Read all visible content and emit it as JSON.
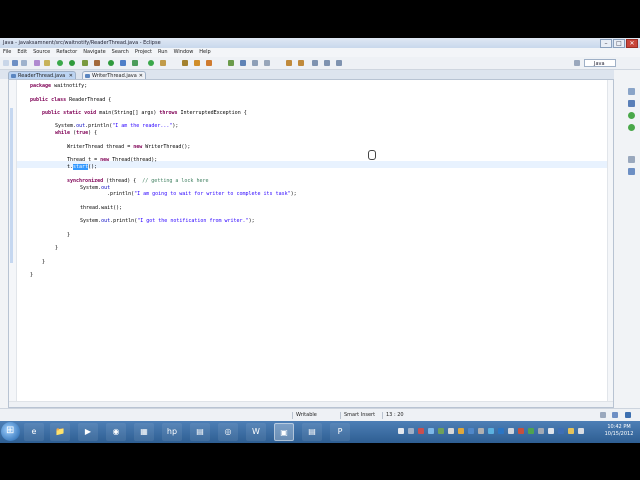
{
  "window": {
    "title": "Java - javaksamnent/src/waitnotify/ReaderThread.java - Eclipse",
    "controls": [
      "–",
      "□",
      "✕"
    ]
  },
  "menu": [
    "File",
    "Edit",
    "Source",
    "Refactor",
    "Navigate",
    "Search",
    "Project",
    "Run",
    "Window",
    "Help"
  ],
  "toolbar": {
    "perspective_label": "Java"
  },
  "tabs": [
    {
      "label": "ReaderThread.java",
      "close": "✕"
    },
    {
      "label": "WriterThread.java",
      "close": "✕"
    }
  ],
  "code": {
    "l1": {
      "kw": "package",
      "rest": " waitnotify;"
    },
    "l2": {
      "kw1": "public",
      "kw2": "class",
      "rest": " ReaderThread {"
    },
    "l3": {
      "kw1": "public",
      "kw2": "static",
      "kw3": "void",
      "a": " main(String[] args) ",
      "kw4": "throws",
      "b": " InterruptedException {"
    },
    "l4": {
      "a": "System.",
      "fld": "out",
      "b": ".println(",
      "str": "\"I am the reader...\"",
      "c": ");"
    },
    "l5": {
      "kw": "while",
      "a": " (",
      "kw2": "true",
      "b": ") {"
    },
    "l6": {
      "a": "WriterThread thread = ",
      "kw": "new",
      "b": " WriterThread();"
    },
    "l7": {
      "a": "Thread t = ",
      "kw": "new",
      "b": " Thread(thread);"
    },
    "l8": {
      "a": "t.",
      "sel": "start",
      "b": "();"
    },
    "l9": {
      "kw": "synchronized",
      "a": " (thread) {  ",
      "cmt": "// getting a lock here"
    },
    "l10": {
      "a": "System.",
      "fld": "out"
    },
    "l11": {
      "a": ".println(",
      "str": "\"I am going to wait for writer to complete its task\"",
      "b": ");"
    },
    "l12": {
      "a": "thread.wait();"
    },
    "l13": {
      "a": "System.",
      "fld": "out",
      "b": ".println(",
      "str": "\"I got the notification from writer.\"",
      "c": ");"
    },
    "l14": "}",
    "l15": "}",
    "l16": "}",
    "l17": "}"
  },
  "status": {
    "writable": "Writable",
    "insert_mode": "Smart Insert",
    "position": "13 : 20"
  },
  "taskbar": {
    "apps": [
      "e",
      "📁",
      "▶",
      "◉",
      "▦",
      "hp",
      "▤",
      "◎",
      "W",
      "▣",
      "▤",
      "P"
    ],
    "clock_time": "10:42 PM",
    "clock_date": "10/15/2012"
  },
  "colors": {
    "keyword": "#7f0055",
    "string": "#2a00ff",
    "comment": "#3f7f5f",
    "field": "#0000c0",
    "selection": "#3399ff"
  }
}
